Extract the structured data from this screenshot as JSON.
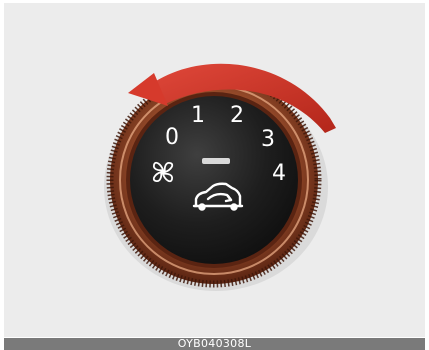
{
  "knob": {
    "positions": [
      "0",
      "1",
      "2",
      "3",
      "4"
    ],
    "icons": [
      "fan-icon",
      "car-recirculation-icon",
      "rotation-arrow-icon"
    ]
  },
  "colors": {
    "arrow": "#d63a2c",
    "ring": "#8a3f24",
    "face": "#1b1b1b",
    "labels": "#ffffff",
    "background": "#ececec",
    "caption_bar": "#7a7a7a"
  },
  "caption": "OYB040308L"
}
